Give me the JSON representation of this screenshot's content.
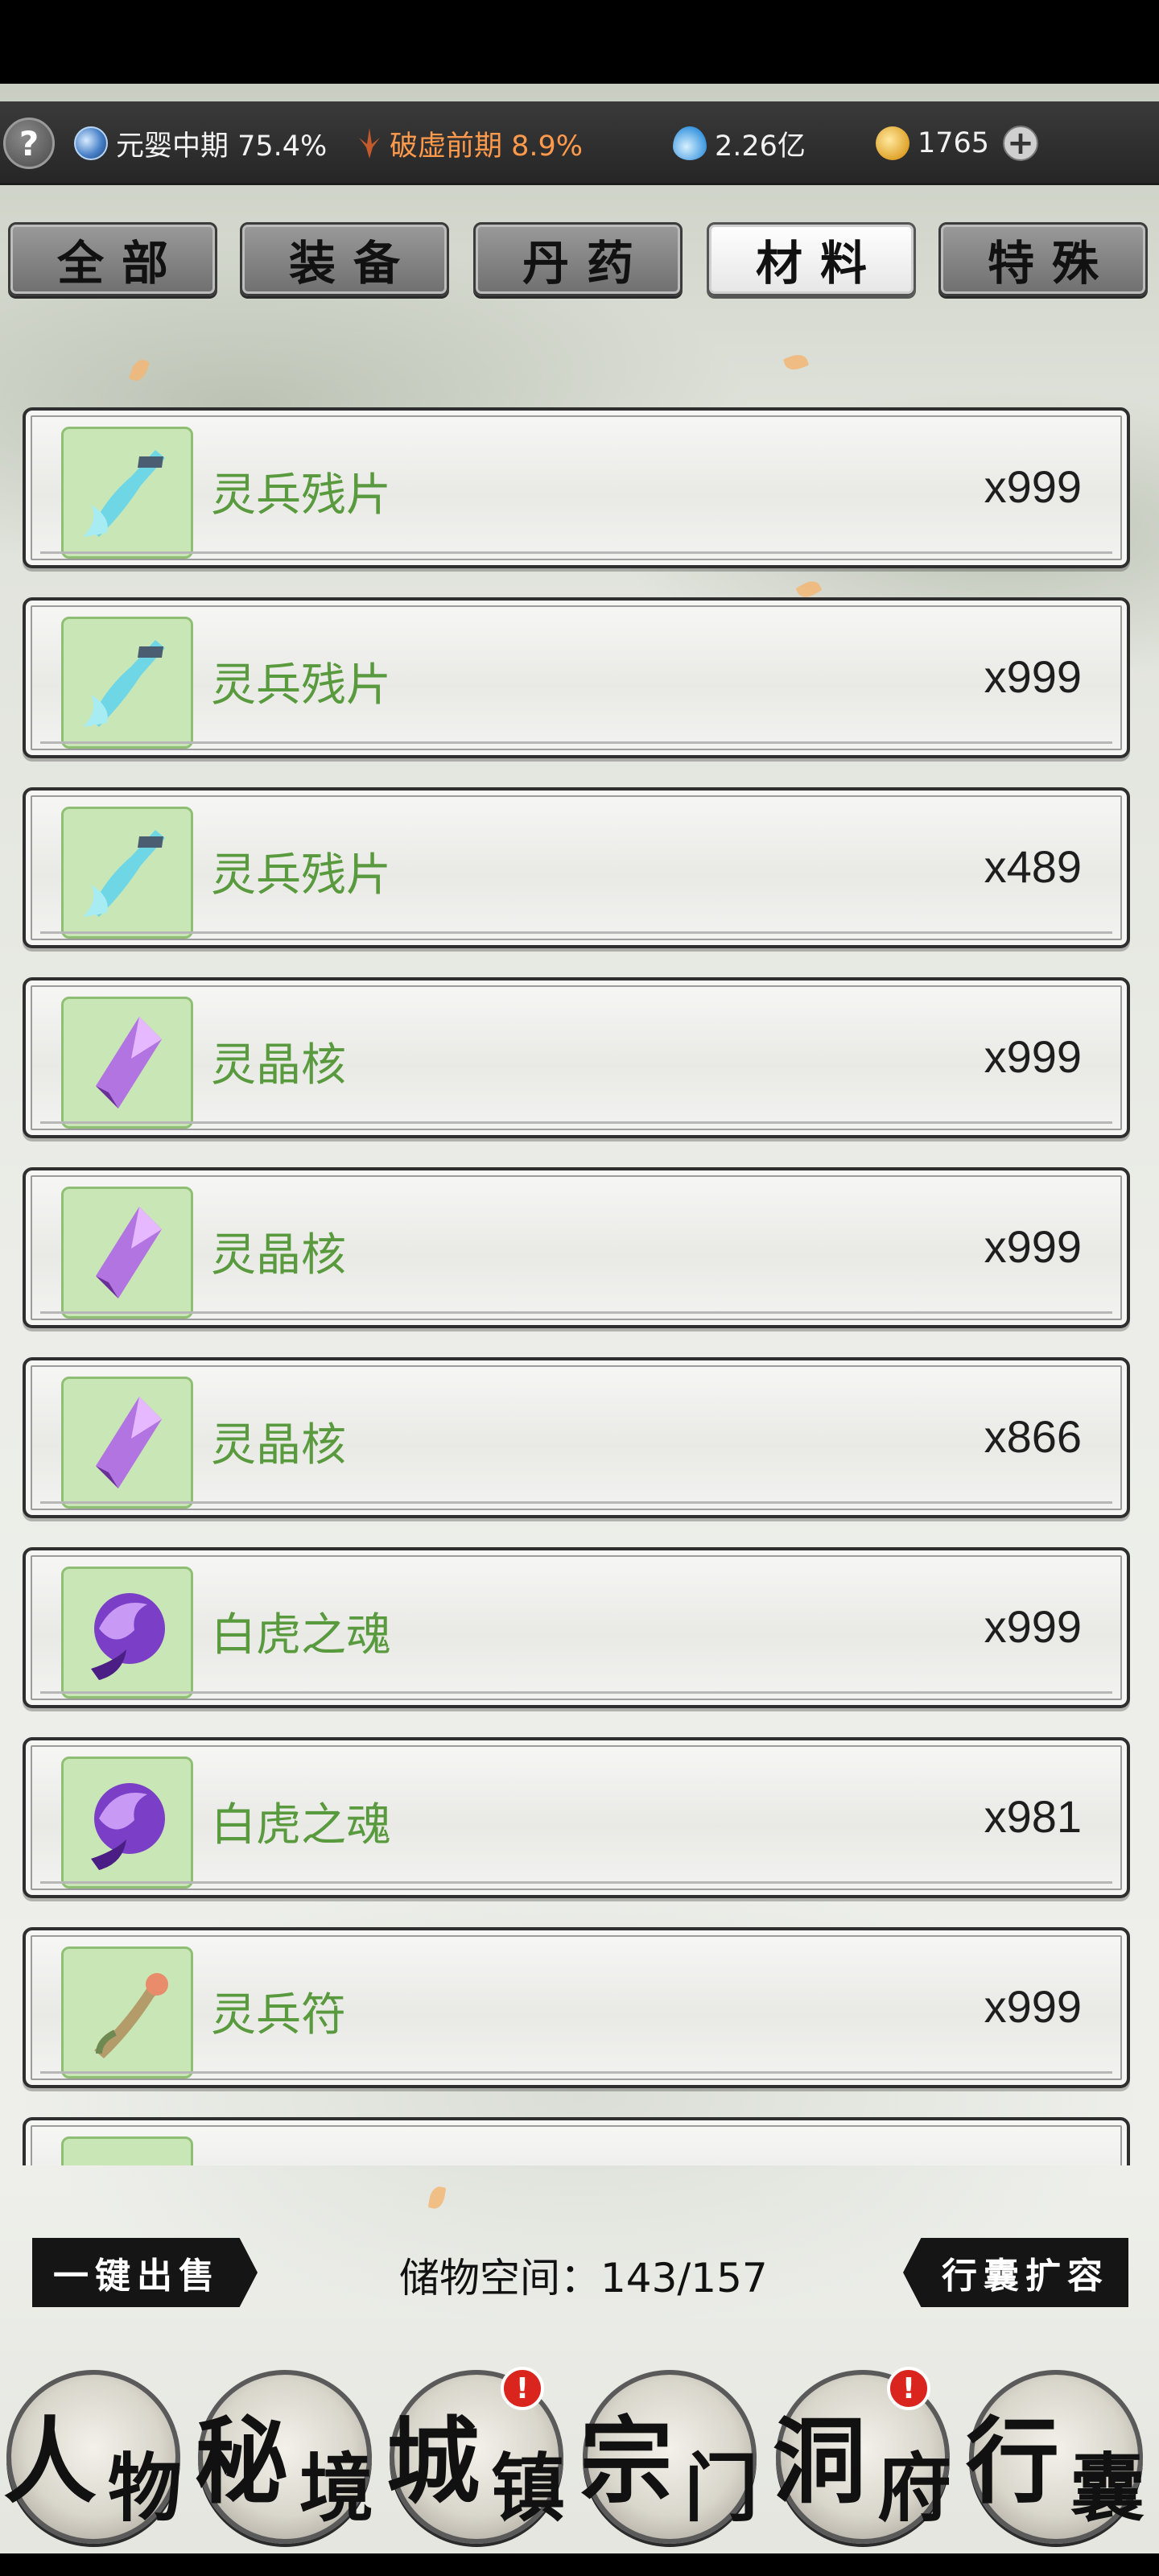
{
  "status": {
    "help": "?",
    "realm": "元婴中期 75.4%",
    "breakthrough": "破虚前期 8.9%",
    "spirit_stones": "2.26亿",
    "currency": "1765",
    "plus": "+"
  },
  "tabs": [
    {
      "label": "全部"
    },
    {
      "label": "装备"
    },
    {
      "label": "丹药"
    },
    {
      "label": "材料"
    },
    {
      "label": "特殊"
    }
  ],
  "active_tab": "材料",
  "items": [
    {
      "name": "灵兵残片",
      "qty": "x999",
      "icon": "sword-fragment-icon"
    },
    {
      "name": "灵兵残片",
      "qty": "x999",
      "icon": "sword-fragment-icon"
    },
    {
      "name": "灵兵残片",
      "qty": "x489",
      "icon": "sword-fragment-icon"
    },
    {
      "name": "灵晶核",
      "qty": "x999",
      "icon": "crystal-core-icon"
    },
    {
      "name": "灵晶核",
      "qty": "x999",
      "icon": "crystal-core-icon"
    },
    {
      "name": "灵晶核",
      "qty": "x866",
      "icon": "crystal-core-icon"
    },
    {
      "name": "白虎之魂",
      "qty": "x999",
      "icon": "tiger-soul-icon"
    },
    {
      "name": "白虎之魂",
      "qty": "x981",
      "icon": "tiger-soul-icon"
    },
    {
      "name": "灵兵符",
      "qty": "x999",
      "icon": "talisman-icon"
    }
  ],
  "toolbar": {
    "sell_all": "一键出售",
    "storage_text": "储物空间：143/157",
    "expand": "行囊扩容"
  },
  "nav": [
    {
      "main": "人",
      "sub": "物",
      "badge": false
    },
    {
      "main": "秘",
      "sub": "境",
      "badge": false
    },
    {
      "main": "城",
      "sub": "镇",
      "badge": true
    },
    {
      "main": "宗",
      "sub": "门",
      "badge": false
    },
    {
      "main": "洞",
      "sub": "府",
      "badge": true
    },
    {
      "main": "行",
      "sub": "囊",
      "badge": false
    }
  ],
  "badge_mark": "!",
  "colors": {
    "item_name": "#5a9a3e",
    "breakthrough": "#ff9a4c",
    "badge": "#d9251d",
    "icon_bg": "#c9e7b6"
  }
}
